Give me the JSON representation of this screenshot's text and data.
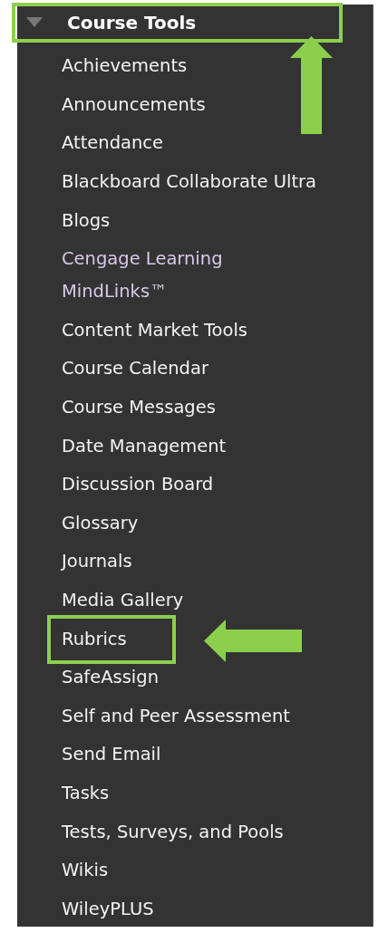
{
  "menu": {
    "title": "Course Tools",
    "expanded": true,
    "highlighted": true,
    "annotation": {
      "kind": "up-arrow"
    },
    "items": [
      {
        "label": "Achievements",
        "visited": false,
        "highlighted": false
      },
      {
        "label": "Announcements",
        "visited": false,
        "highlighted": false
      },
      {
        "label": "Attendance",
        "visited": false,
        "highlighted": false
      },
      {
        "label": "Blackboard Collaborate Ultra",
        "visited": false,
        "highlighted": false
      },
      {
        "label": "Blogs",
        "visited": false,
        "highlighted": false
      },
      {
        "label": "Cengage Learning\nMindLinks™",
        "visited": true,
        "highlighted": false
      },
      {
        "label": "Content Market Tools",
        "visited": false,
        "highlighted": false
      },
      {
        "label": "Course Calendar",
        "visited": false,
        "highlighted": false
      },
      {
        "label": "Course Messages",
        "visited": false,
        "highlighted": false
      },
      {
        "label": "Date Management",
        "visited": false,
        "highlighted": false
      },
      {
        "label": "Discussion Board",
        "visited": false,
        "highlighted": false
      },
      {
        "label": "Glossary",
        "visited": false,
        "highlighted": false
      },
      {
        "label": "Journals",
        "visited": false,
        "highlighted": false
      },
      {
        "label": "Media Gallery",
        "visited": false,
        "highlighted": false
      },
      {
        "label": "Rubrics",
        "visited": false,
        "highlighted": true,
        "annotation": {
          "kind": "left-arrow"
        }
      },
      {
        "label": "SafeAssign",
        "visited": false,
        "highlighted": false
      },
      {
        "label": "Self and Peer Assessment",
        "visited": false,
        "highlighted": false
      },
      {
        "label": "Send Email",
        "visited": false,
        "highlighted": false
      },
      {
        "label": "Tasks",
        "visited": false,
        "highlighted": false
      },
      {
        "label": "Tests, Surveys, and Pools",
        "visited": false,
        "highlighted": false
      },
      {
        "label": "Wikis",
        "visited": false,
        "highlighted": false
      },
      {
        "label": "WileyPLUS",
        "visited": false,
        "highlighted": false
      }
    ]
  }
}
